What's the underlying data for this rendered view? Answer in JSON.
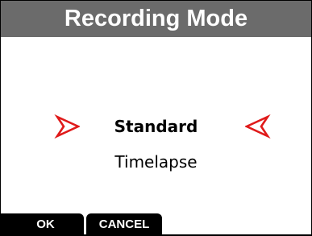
{
  "header": {
    "title": "Recording Mode"
  },
  "menu": {
    "selected_option": "Standard",
    "other_option": "Timelapse",
    "indicator_color": "#e01a1a"
  },
  "softkeys": {
    "ok_label": "OK",
    "cancel_label": "CANCEL"
  },
  "colors": {
    "title_bar": "#6b6b6b",
    "background": "#ffffff",
    "softkey_bg": "#000000"
  },
  "icons": {
    "left_indicator": "arrow-right-outline",
    "right_indicator": "arrow-left-outline"
  }
}
